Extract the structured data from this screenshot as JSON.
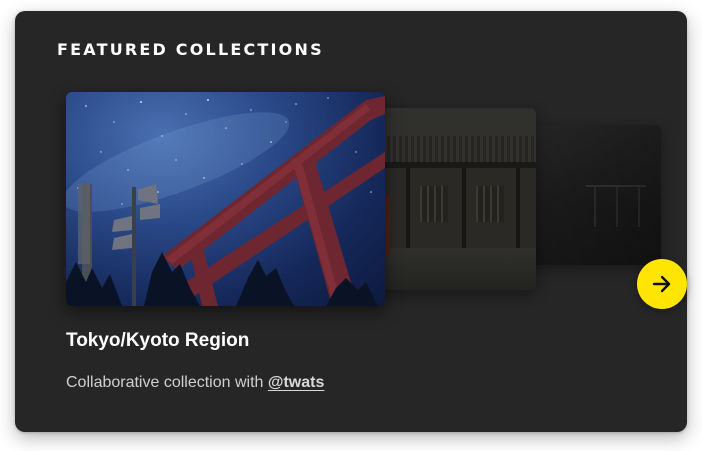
{
  "section": {
    "heading": "FEATURED COLLECTIONS"
  },
  "carousel": {
    "images": [
      {
        "icon": "torii-gate-night-image"
      },
      {
        "icon": "japanese-building-image"
      },
      {
        "icon": "railing-dark-image"
      }
    ],
    "next_icon": "arrow-right-icon"
  },
  "collection": {
    "title": "Tokyo/Kyoto Region",
    "description_prefix": "Collaborative collection with ",
    "collaborator": "@twats"
  },
  "colors": {
    "card_background": "#262626",
    "accent": "#ffe500",
    "text_primary": "#ffffff",
    "text_secondary": "#cfcfcf"
  }
}
